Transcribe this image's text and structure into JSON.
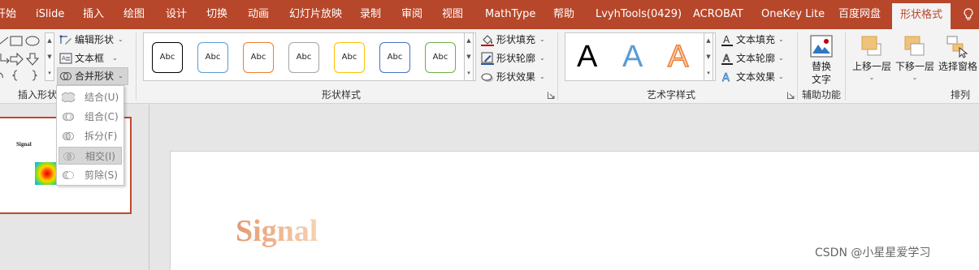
{
  "tabs": [
    {
      "label": "开始",
      "active": false
    },
    {
      "label": "iSlide",
      "active": false
    },
    {
      "label": "插入",
      "active": false
    },
    {
      "label": "绘图",
      "active": false
    },
    {
      "label": "设计",
      "active": false
    },
    {
      "label": "切换",
      "active": false
    },
    {
      "label": "动画",
      "active": false
    },
    {
      "label": "幻灯片放映",
      "active": false
    },
    {
      "label": "录制",
      "active": false
    },
    {
      "label": "审阅",
      "active": false
    },
    {
      "label": "视图",
      "active": false
    },
    {
      "label": "MathType",
      "active": false
    },
    {
      "label": "帮助",
      "active": false
    },
    {
      "label": "LvyhTools(0429)",
      "active": false
    },
    {
      "label": "ACROBAT",
      "active": false
    },
    {
      "label": "OneKey Lite",
      "active": false
    },
    {
      "label": "百度网盘",
      "active": false
    },
    {
      "label": "形状格式",
      "active": true
    }
  ],
  "ribbon": {
    "insert_shapes": {
      "label": "插入形状",
      "edit_shape": "编辑形状",
      "text_box": "文本框",
      "merge_shapes": "合并形状"
    },
    "shape_styles": {
      "label": "形状样式",
      "preset_text": "Abc",
      "preset_colors": [
        "#000000",
        "#5b9bd5",
        "#ed7d31",
        "#a5a5a5",
        "#ffc000",
        "#4472c4",
        "#70ad47"
      ],
      "fill": "形状填充",
      "outline": "形状轮廓",
      "effects": "形状效果"
    },
    "wordart_styles": {
      "label": "艺术字样式",
      "sample_letter": "A",
      "text_fill": "文本填充",
      "text_outline": "文本轮廓",
      "text_effects": "文本效果"
    },
    "accessibility": {
      "label": "辅助功能",
      "alt_text_line1": "替换",
      "alt_text_line2": "文字"
    },
    "arrange": {
      "label": "排列",
      "bring_forward": "上移一层",
      "send_backward": "下移一层",
      "selection_pane": "选择窗格"
    }
  },
  "merge_menu": {
    "items": [
      {
        "label": "结合(U)",
        "highlighted": false
      },
      {
        "label": "组合(C)",
        "highlighted": false
      },
      {
        "label": "拆分(F)",
        "highlighted": false
      },
      {
        "label": "相交(I)",
        "highlighted": true
      },
      {
        "label": "剪除(S)",
        "highlighted": false
      }
    ]
  },
  "thumbnail": {
    "title": "Signal"
  },
  "slide": {
    "title": "Signal"
  },
  "watermark": "CSDN @小星星爱学习",
  "colors": {
    "accent": "#b7472a",
    "ribbon_bg": "#f3f3f3",
    "title_gradient_start": "#e8a27a",
    "title_gradient_end": "#f5cfae"
  }
}
